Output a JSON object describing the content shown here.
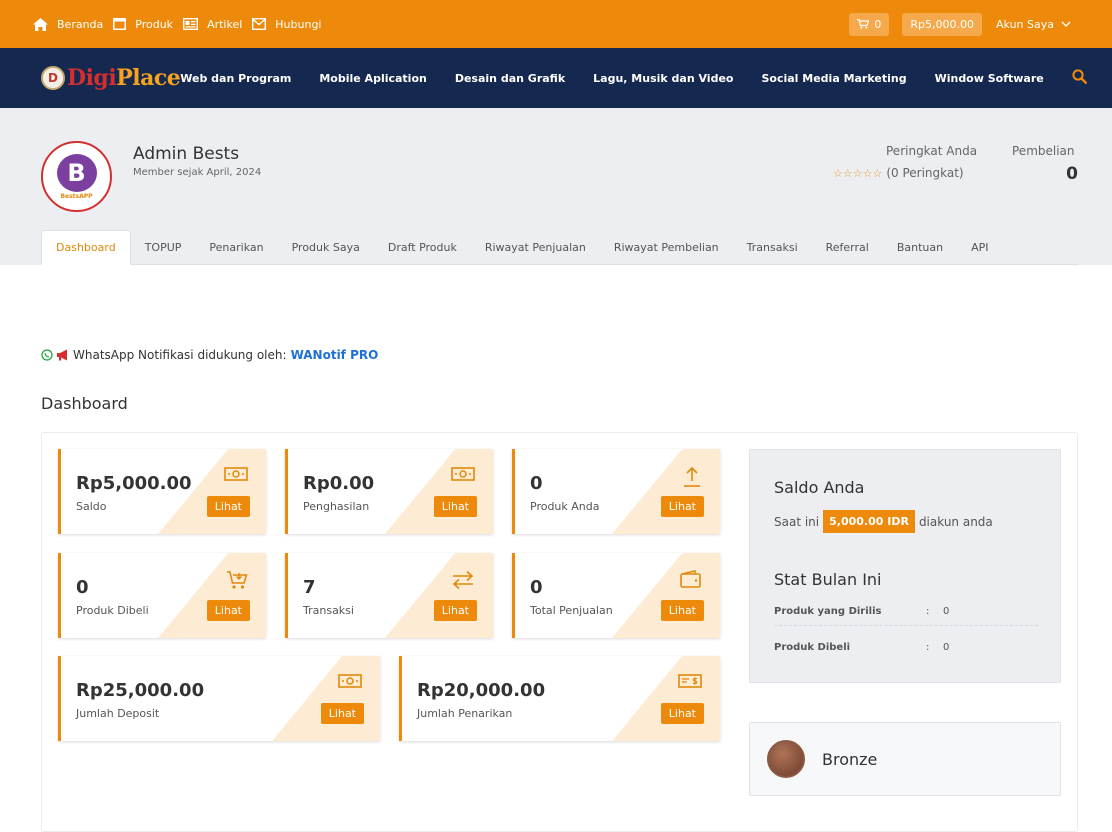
{
  "topbar": {
    "links": [
      "Beranda",
      "Produk",
      "Artikel",
      "Hubungi"
    ],
    "cart_count": "0",
    "balance": "Rp5,000.00",
    "account": "Akun Saya"
  },
  "brand": {
    "logo_mark": "D",
    "logo_a": "Digi",
    "logo_b": "Place"
  },
  "menu": [
    "Web dan Program",
    "Mobile Aplication",
    "Desain dan Grafik",
    "Lagu, Musik dan Video",
    "Social Media Marketing",
    "Window Software"
  ],
  "profile": {
    "avatar_letter": "B",
    "avatar_caption": "BestsAPP",
    "name": "Admin Bests",
    "member_since": "Member sejak April, 2024",
    "rank_label": "Peringkat Anda",
    "rank_stars": "☆☆☆☆☆",
    "rank_value": "(0 Peringkat)",
    "purchase_label": "Pembelian",
    "purchase_value": "0"
  },
  "tabs": [
    "Dashboard",
    "TOPUP",
    "Penarikan",
    "Produk Saya",
    "Draft Produk",
    "Riwayat Penjualan",
    "Riwayat Pembelian",
    "Transaksi",
    "Referral",
    "Bantuan",
    "API"
  ],
  "notice": {
    "text": "WhatsApp Notifikasi didukung oleh:",
    "link": "WANotif PRO"
  },
  "dashboard_title": "Dashboard",
  "cards": [
    {
      "value": "Rp5,000.00",
      "label": "Saldo",
      "button": "Lihat",
      "icon": "money-icon"
    },
    {
      "value": "Rp0.00",
      "label": "Penghasilan",
      "button": "Lihat",
      "icon": "money-icon"
    },
    {
      "value": "0",
      "label": "Produk Anda",
      "button": "Lihat",
      "icon": "upload-icon"
    },
    {
      "value": "0",
      "label": "Produk Dibeli",
      "button": "Lihat",
      "icon": "cart-icon"
    },
    {
      "value": "7",
      "label": "Transaksi",
      "button": "Lihat",
      "icon": "exchange-icon"
    },
    {
      "value": "0",
      "label": "Total Penjualan",
      "button": "Lihat",
      "icon": "wallet-icon"
    },
    {
      "value": "Rp25,000.00",
      "label": "Jumlah Deposit",
      "button": "Lihat",
      "icon": "money-icon"
    },
    {
      "value": "Rp20,000.00",
      "label": "Jumlah Penarikan",
      "button": "Lihat",
      "icon": "check-money-icon"
    }
  ],
  "saldo": {
    "title": "Saldo Anda",
    "prefix": "Saat ini",
    "amount": "5,000.00 IDR",
    "suffix": "diakun anda"
  },
  "stats": {
    "title": "Stat Bulan Ini",
    "rows": [
      {
        "label": "Produk yang Dirilis",
        "value": "0"
      },
      {
        "label": "Produk Dibeli",
        "value": "0"
      }
    ],
    "colon": ":"
  },
  "level": {
    "label": "Bronze"
  },
  "colors": {
    "accent": "#ee8a0b",
    "navy": "#142850",
    "link": "#1e6fd6"
  }
}
